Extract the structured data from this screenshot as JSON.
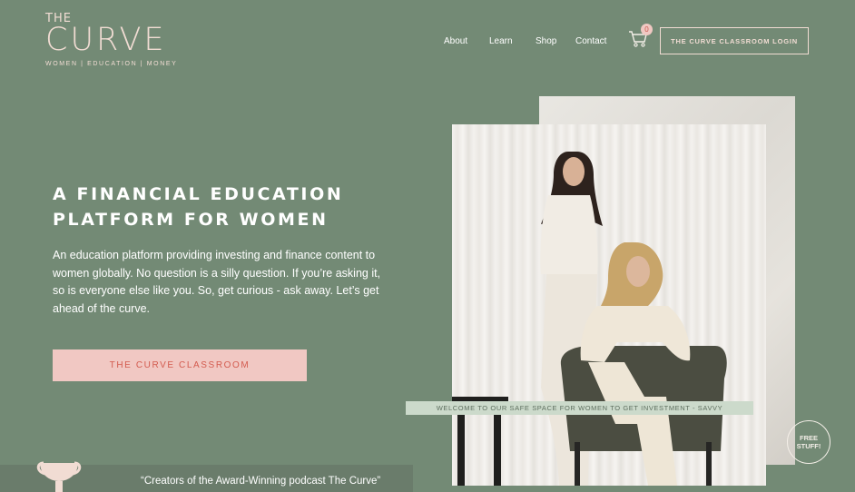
{
  "brand": {
    "logo_the": "THE",
    "logo_main": "CURVE",
    "logo_tagline": "WOMEN | EDUCATION | MONEY"
  },
  "nav": {
    "items": [
      "About",
      "Learn",
      "Shop",
      "Contact"
    ],
    "cart_count": "0",
    "login_label": "THE CURVE CLASSROOM LOGIN"
  },
  "hero": {
    "title_line1": "A FINANCIAL EDUCATION",
    "title_line2": "PLATFORM FOR WOMEN",
    "description": "An education platform providing investing and finance content to women globally. No question is a silly question. If you’re asking it, so is everyone else like you. So, get curious - ask away. Let’s get ahead of the curve.",
    "cta_label": "THE CURVE CLASSROOM"
  },
  "photo": {
    "caption": "WELCOME TO OUR SAFE SPACE FOR WOMEN TO GET INVESTMENT - SAVVY"
  },
  "free_stuff": {
    "line1": "FREE",
    "line2": "STUFF!"
  },
  "footer": {
    "podcast_text": "“Creators of the Award-Winning podcast The Curve”"
  },
  "colors": {
    "background": "#738a75",
    "accent_pink": "#f1c8c3",
    "accent_red": "#d35b4f",
    "logo_cream": "#f1dcd3",
    "caption_bg": "#ccdacb"
  },
  "icons": [
    "cart-icon",
    "trophy-icon"
  ]
}
